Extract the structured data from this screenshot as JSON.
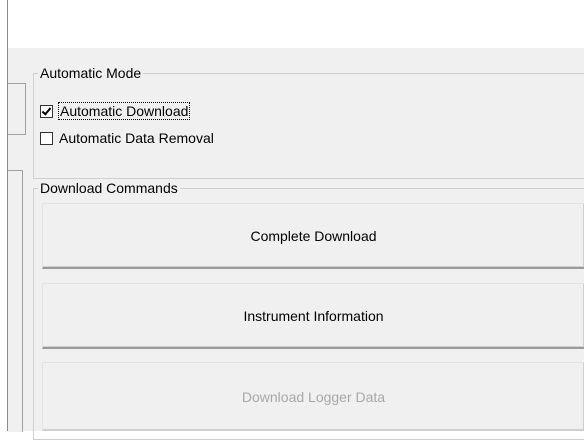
{
  "automatic_mode": {
    "title": "Automatic Mode",
    "options": [
      {
        "label": "Automatic Download",
        "checked": true,
        "focused": true
      },
      {
        "label": "Automatic Data Removal",
        "checked": false,
        "focused": false
      }
    ]
  },
  "download_commands": {
    "title": "Download Commands",
    "buttons": [
      {
        "label": "Complete Download",
        "enabled": true
      },
      {
        "label": "Instrument Information",
        "enabled": true
      },
      {
        "label": "Download Logger Data",
        "enabled": false
      }
    ]
  }
}
